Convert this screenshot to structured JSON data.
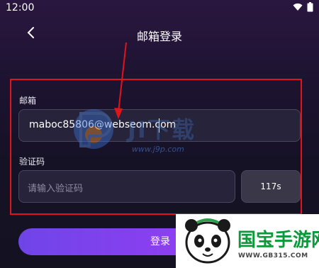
{
  "status_bar": {
    "time": "12:00"
  },
  "header": {
    "title": "邮箱登录"
  },
  "email": {
    "label": "邮箱",
    "value": "maboc85806@webseom.com"
  },
  "code": {
    "label": "验证码",
    "placeholder": "请输入验证码",
    "countdown": "117s"
  },
  "login_button": {
    "label": "登录"
  },
  "watermark": {
    "text": "JI下载",
    "url": "www.j9p.com"
  },
  "site_badge": {
    "brand": "国宝手游网",
    "url": "WWW.GB315.COM"
  },
  "colors": {
    "accent": "#8a3ff0",
    "highlight_border": "#e0141b",
    "brand_green": "#0a9a3a"
  },
  "icons": [
    "back-chevron-icon",
    "wifi-icon",
    "battery-icon",
    "arrow-annotation",
    "panda-icon"
  ]
}
